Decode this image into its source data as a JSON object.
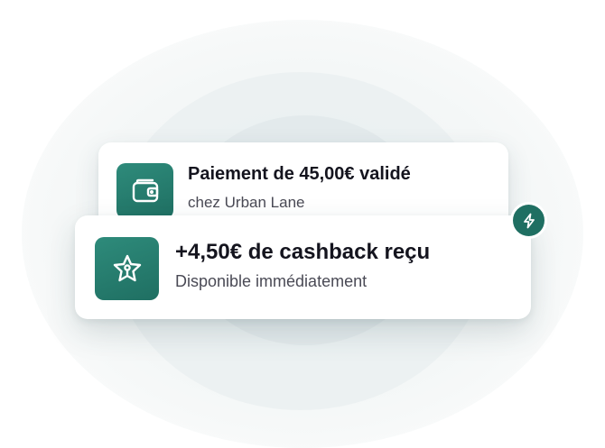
{
  "payment_card": {
    "title": "Paiement de 45,00€ validé",
    "subtitle": "chez Urban Lane",
    "icon": "wallet-icon"
  },
  "cashback_card": {
    "title": "+4,50€ de cashback reçu",
    "subtitle": "Disponible immédiatement",
    "icon": "star-icon"
  },
  "badge": {
    "icon": "lightning-bolt-icon"
  },
  "colors": {
    "accent": "#1f6f62",
    "accent_light": "#2e8b7b",
    "title_text": "#14141e",
    "subtitle_text": "#4a4a55",
    "halo": "#e3eaec"
  }
}
